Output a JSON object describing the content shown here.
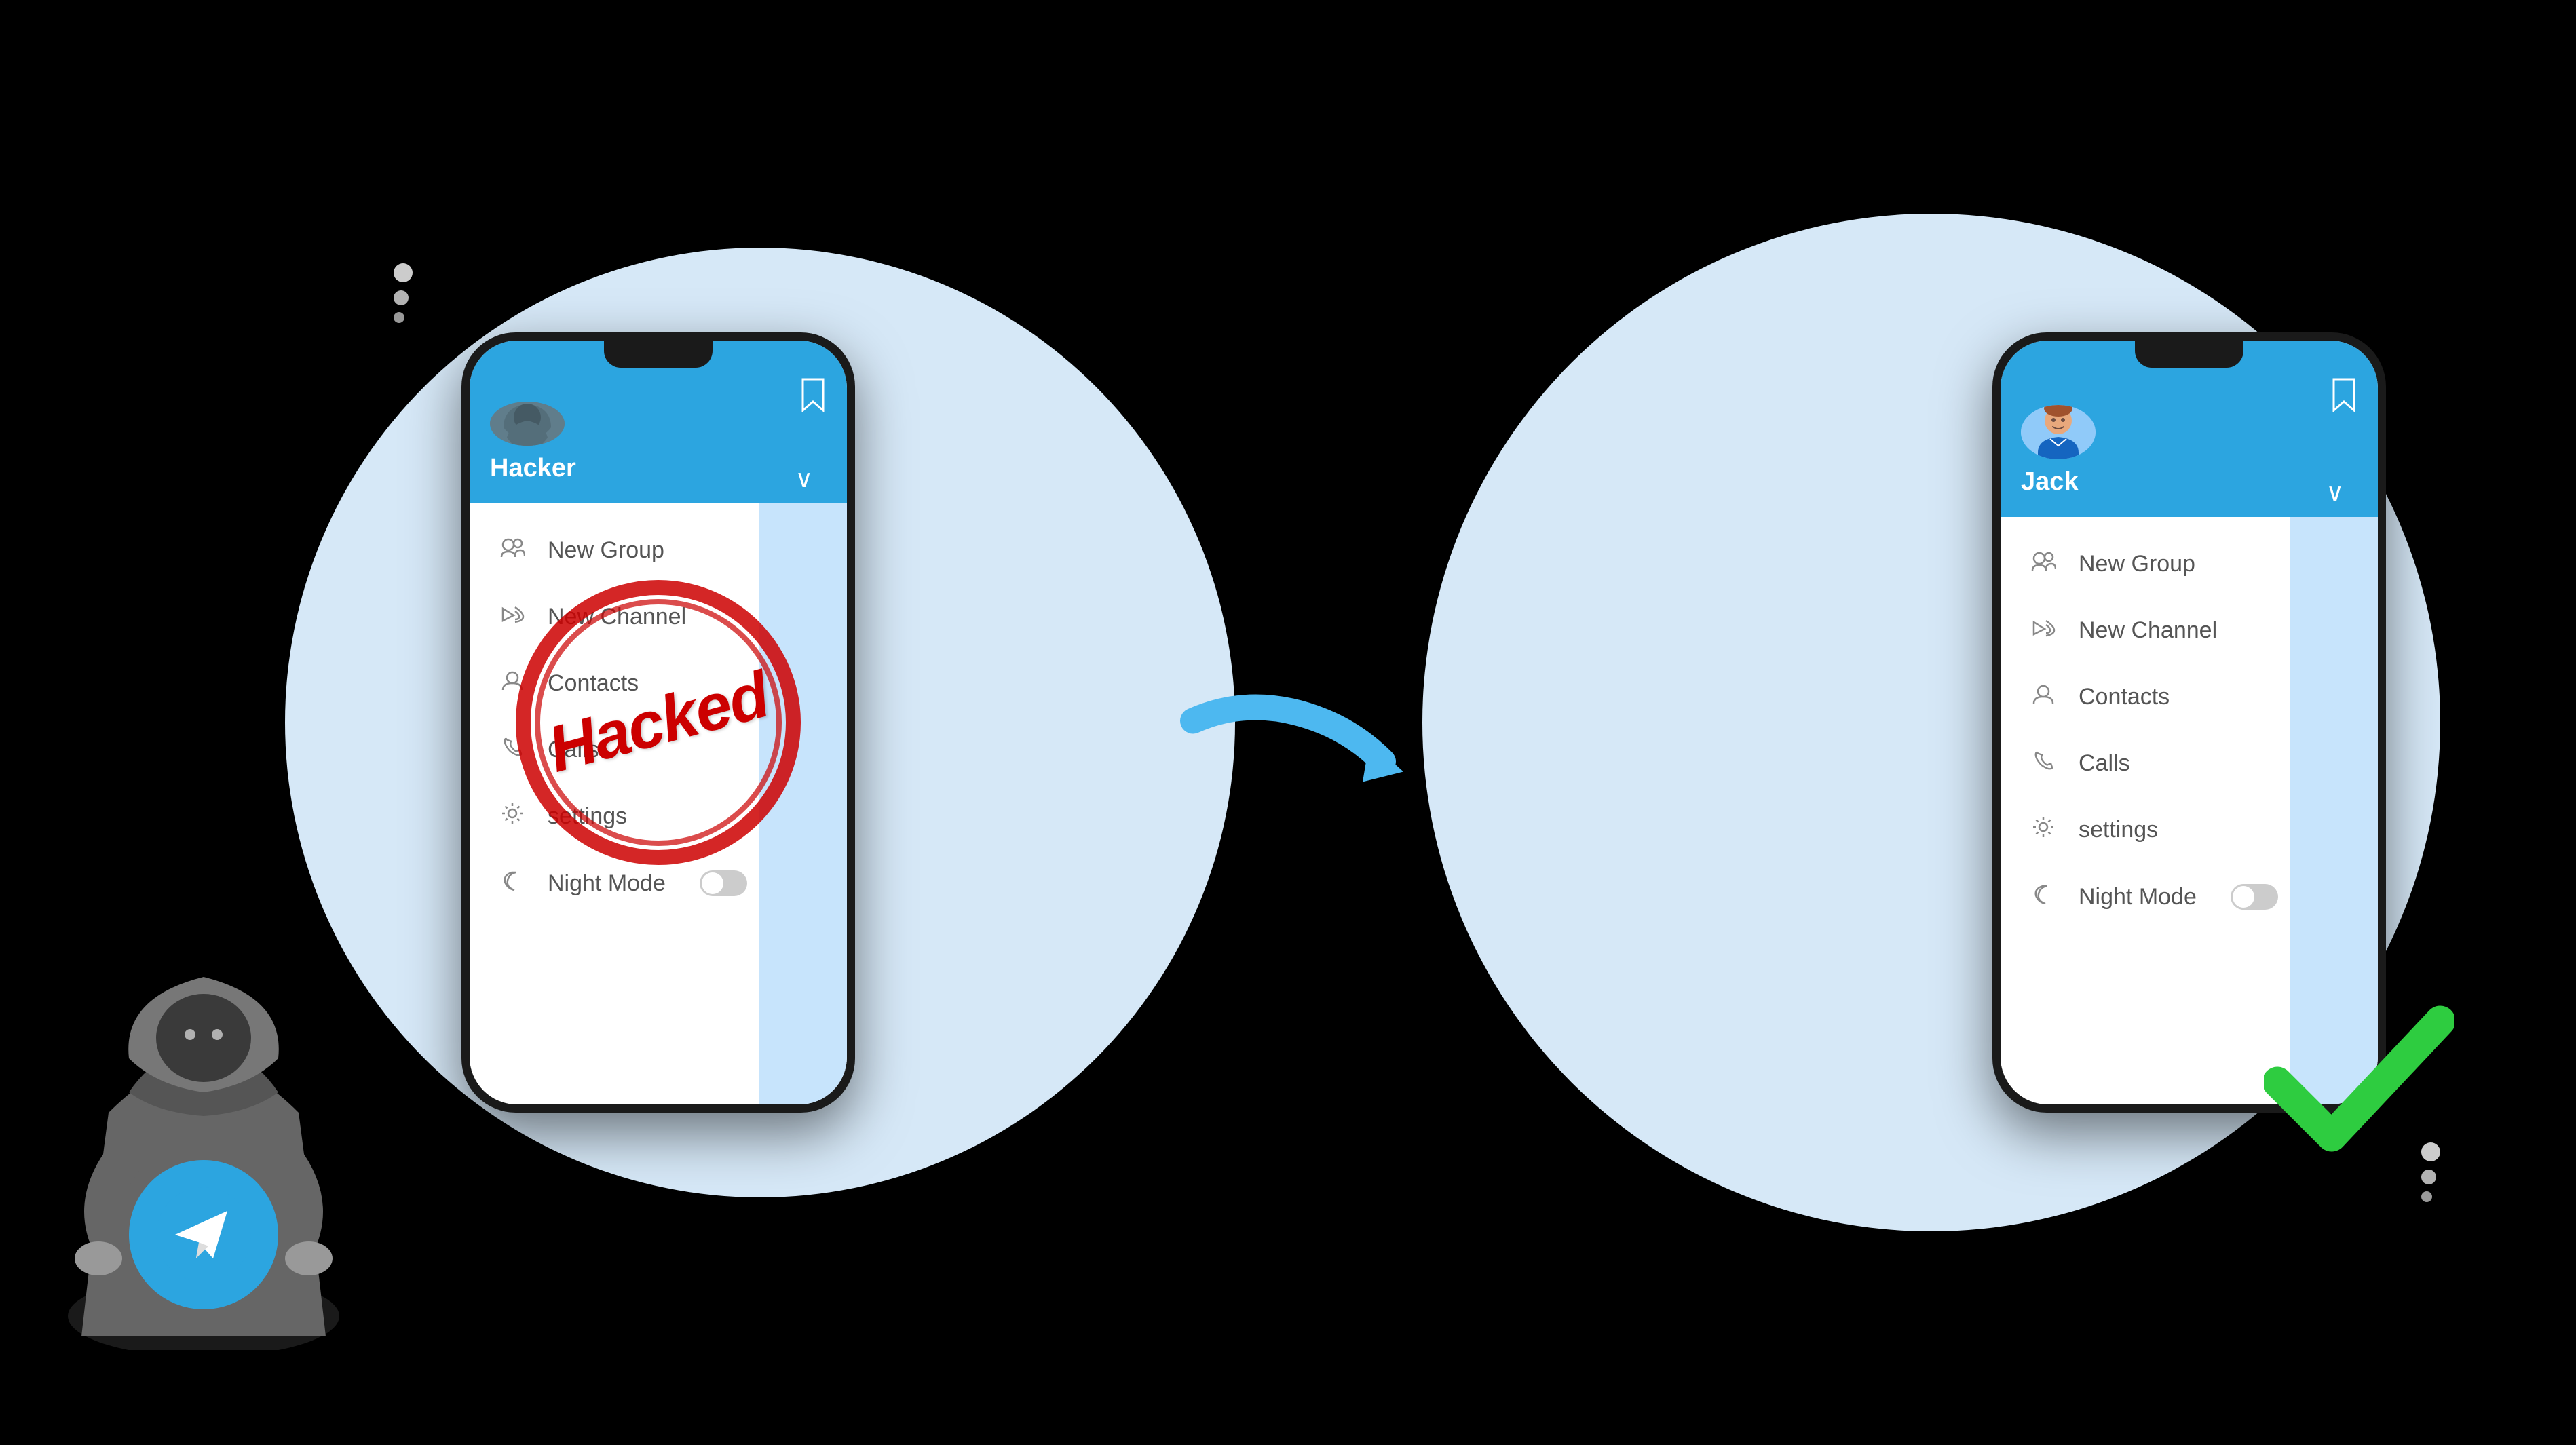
{
  "scene": {
    "background": "#000000",
    "blobColor": "#d6e8f7"
  },
  "leftPhone": {
    "user": {
      "name": "Hacker",
      "avatarType": "hacker"
    },
    "hacked": true,
    "hackedLabel": "Hacked",
    "menu": [
      {
        "icon": "👥",
        "label": "New Group",
        "iconName": "new-group-icon"
      },
      {
        "icon": "📢",
        "label": "New Channel",
        "iconName": "new-channel-icon"
      },
      {
        "icon": "👤",
        "label": "Contacts",
        "iconName": "contacts-icon"
      },
      {
        "icon": "📞",
        "label": "Calls",
        "iconName": "calls-icon"
      },
      {
        "icon": "⚙️",
        "label": "settings",
        "iconName": "settings-icon"
      },
      {
        "icon": "🌙",
        "label": "Night Mode",
        "iconName": "night-mode-icon",
        "hasToggle": true
      }
    ]
  },
  "rightPhone": {
    "user": {
      "name": "Jack",
      "avatarType": "normal"
    },
    "hacked": false,
    "menu": [
      {
        "icon": "👥",
        "label": "New Group",
        "iconName": "new-group-icon"
      },
      {
        "icon": "📢",
        "label": "New Channel",
        "iconName": "new-channel-icon"
      },
      {
        "icon": "👤",
        "label": "Contacts",
        "iconName": "contacts-icon"
      },
      {
        "icon": "📞",
        "label": "Calls",
        "iconName": "calls-icon"
      },
      {
        "icon": "⚙️",
        "label": "settings",
        "iconName": "settings-icon"
      },
      {
        "icon": "🌙",
        "label": "Night Mode",
        "iconName": "night-mode-icon",
        "hasToggle": true
      }
    ]
  },
  "arrow": {
    "direction": "right",
    "color": "#4db8f0"
  },
  "decorativeDots": {
    "leftDots": 3,
    "rightDots": 3
  }
}
